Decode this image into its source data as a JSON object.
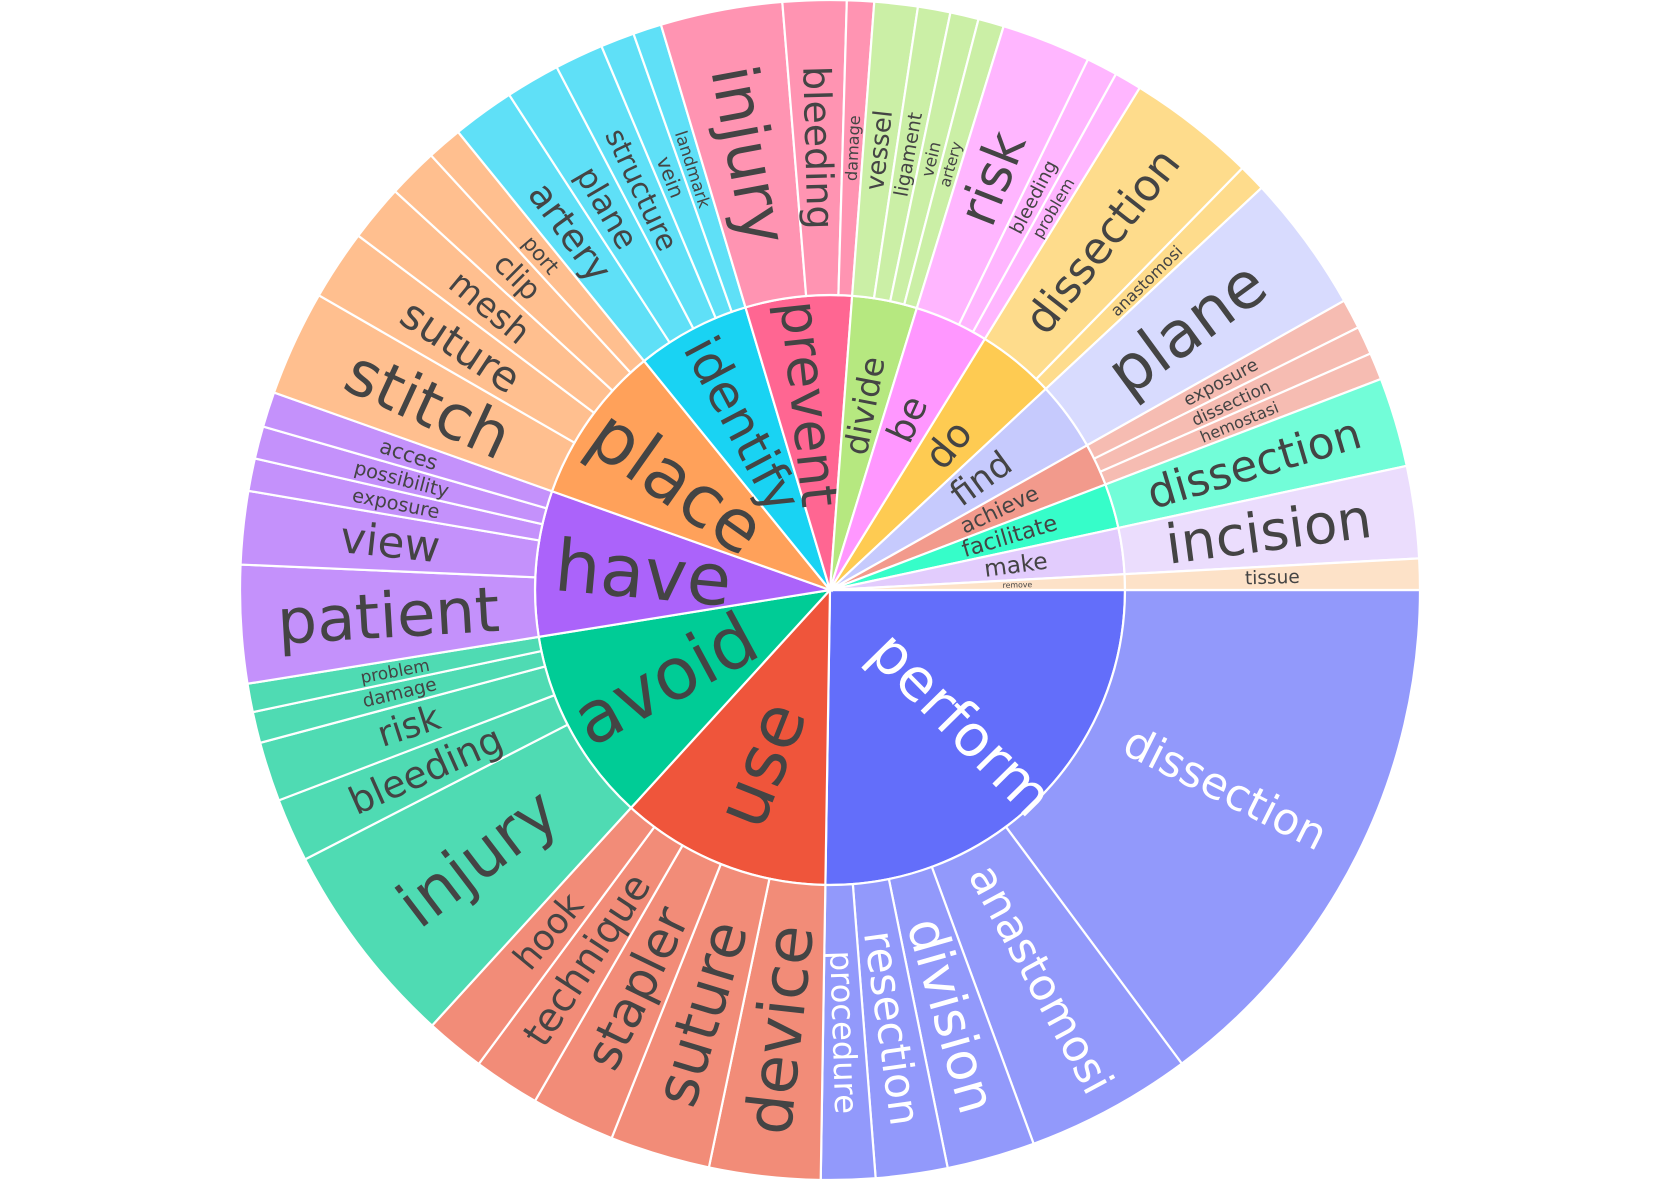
{
  "chart_data": {
    "type": "sunburst",
    "title": "",
    "verbs": [
      {
        "name": "perform",
        "color": "#636efa",
        "child_color": "#9299fb",
        "label_color": "#ffffff",
        "children": [
          [
            "dissection",
            40
          ],
          [
            "anastomosi",
            12.3
          ],
          [
            "division",
            6.5
          ],
          [
            "resection",
            5.3
          ],
          [
            "procedure",
            4
          ]
        ]
      },
      {
        "name": "use",
        "color": "#ef553b",
        "child_color": "#f28c78",
        "label_color": "#444444",
        "children": [
          [
            "device",
            8.2
          ],
          [
            "suture",
            7.4
          ],
          [
            "stapler",
            6.2
          ],
          [
            "technique",
            4.9
          ],
          [
            "hook",
            4.4
          ]
        ]
      },
      {
        "name": "avoid",
        "color": "#00cc96",
        "child_color": "#4fdbb3",
        "label_color": "#444444",
        "children": [
          [
            "injury",
            15.3
          ],
          [
            "bleeding",
            4.7
          ],
          [
            "risk",
            4.4
          ],
          [
            "damage",
            2.3
          ],
          [
            "problem",
            2.1
          ]
        ]
      },
      {
        "name": "have",
        "color": "#ab63fa",
        "child_color": "#c491fb",
        "label_color": "#444444",
        "children": [
          [
            "patient",
            8.7
          ],
          [
            "view",
            5.4
          ],
          [
            "exposure",
            2.4
          ],
          [
            "possibility",
            2.4
          ],
          [
            "acces",
            2.6
          ]
        ]
      },
      {
        "name": "place",
        "color": "#ffa15a",
        "child_color": "#ffbf8f",
        "label_color": "#444444",
        "children": [
          [
            "stitch",
            7.8
          ],
          [
            "suture",
            5.2
          ],
          [
            "mesh",
            4.2
          ],
          [
            "clip",
            3.7
          ],
          [
            "port",
            2.6
          ]
        ]
      },
      {
        "name": "identify",
        "color": "#19d3f3",
        "child_color": "#5fe0f7",
        "label_color": "#444444",
        "children": [
          [
            "artery",
            4.6
          ],
          [
            "plane",
            4
          ],
          [
            "structure",
            3.6
          ],
          [
            "vein",
            2.5
          ],
          [
            "landmark",
            2.1
          ]
        ]
      },
      {
        "name": "prevent",
        "color": "#ff6692",
        "child_color": "#ff94b2",
        "label_color": "#444444",
        "children": [
          [
            "injury",
            9
          ],
          [
            "bleeding",
            4.7
          ],
          [
            "damage",
            2
          ]
        ]
      },
      {
        "name": "divide",
        "color": "#b6e880",
        "child_color": "#cbefa6",
        "label_color": "#444444",
        "children": [
          [
            "vessel",
            3.2
          ],
          [
            "ligament",
            2.4
          ],
          [
            "vein",
            2.1
          ],
          [
            "artery",
            1.9
          ]
        ]
      },
      {
        "name": "be",
        "color": "#ff97ff",
        "child_color": "#ffb6ff",
        "label_color": "#444444",
        "children": [
          [
            "risk",
            6.6
          ],
          [
            "bleeding",
            2.3
          ],
          [
            "problem",
            2
          ]
        ]
      },
      {
        "name": "do",
        "color": "#fecb52",
        "child_color": "#fedc8c",
        "label_color": "#444444",
        "children": [
          [
            "dissection",
            9.5
          ],
          [
            "anastomosi",
            2
          ]
        ]
      },
      {
        "name": "find",
        "color": "#c6cafd",
        "child_color": "#d8dbfe",
        "label_color": "#444444",
        "children": [
          [
            "plane",
            10.2
          ]
        ]
      },
      {
        "name": "achieve",
        "color": "#f29a8c",
        "child_color": "#f6bcb2",
        "label_color": "#444444",
        "children": [
          [
            "exposure",
            2.2
          ],
          [
            "dissection",
            2.1
          ],
          [
            "hemostasi",
            2
          ]
        ]
      },
      {
        "name": "facilitate",
        "color": "#36fdc9",
        "child_color": "#72fdd8",
        "label_color": "#444444",
        "children": [
          [
            "dissection",
            6.6
          ]
        ]
      },
      {
        "name": "make",
        "color": "#e2ccfd",
        "child_color": "#ebddfd",
        "label_color": "#444444",
        "children": [
          [
            "incision",
            6.8
          ]
        ]
      },
      {
        "name": "remove",
        "color": "#fde2c8",
        "child_color": "#fde2c8",
        "label_color": "#444444",
        "children": [
          [
            "tissue",
            2.3
          ]
        ]
      }
    ]
  }
}
